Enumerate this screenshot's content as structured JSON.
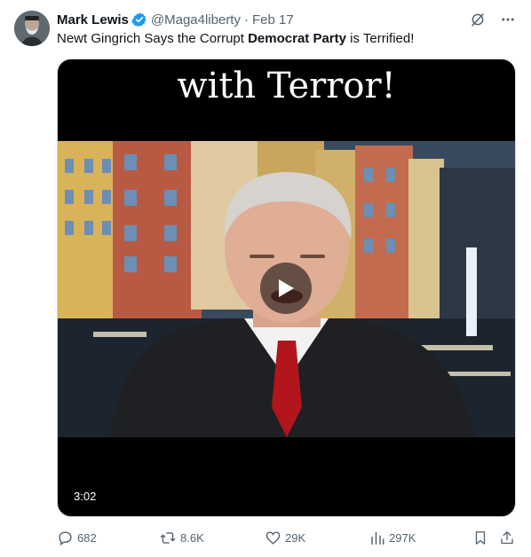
{
  "tweet": {
    "author_name": "Mark Lewis",
    "handle": "@Maga4liberty",
    "separator": "·",
    "date": "Feb 17",
    "text_part1": "Newt Gingrich Says the Corrupt ",
    "text_bold": "Democrat Party",
    "text_part2": " is Terrified!"
  },
  "media": {
    "caption": "with Terror!",
    "duration": "3:02"
  },
  "actions": {
    "replies": "682",
    "reposts": "8.6K",
    "likes": "29K",
    "views": "297K"
  },
  "colors": {
    "verified": "#1d9bf0",
    "secondary_text": "#536471",
    "tie": "#b3151d"
  },
  "icons": [
    "avatar",
    "verified-badge-icon",
    "grok-icon",
    "more-icon",
    "play-icon",
    "reply-icon",
    "repost-icon",
    "like-icon",
    "views-icon",
    "bookmark-icon",
    "share-icon"
  ]
}
